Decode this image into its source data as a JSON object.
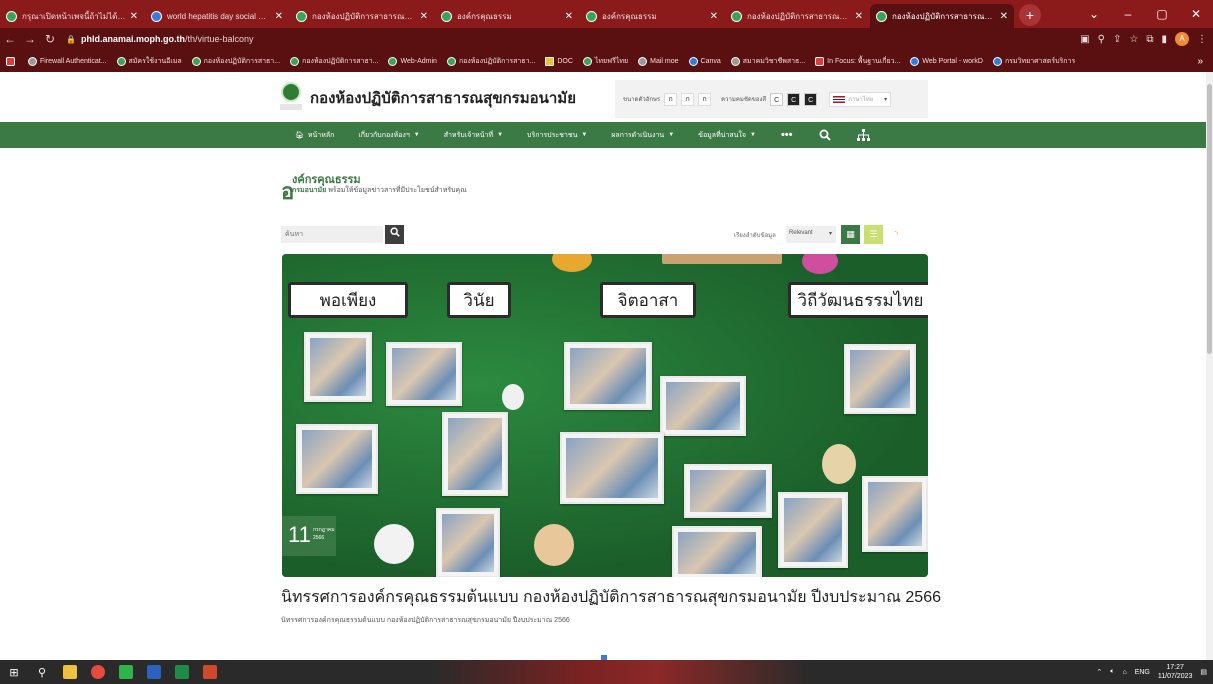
{
  "browser": {
    "tabs": [
      {
        "title": "กรุณาเปิดหน้าเพจนี้ถ้าไม่ได้รับ",
        "active": false
      },
      {
        "title": "world hepatitis day social med",
        "active": false
      },
      {
        "title": "กองห้องปฏิบัติการสาธารณสุขกรม",
        "active": false
      },
      {
        "title": "องค์กรคุณธรรม",
        "active": false
      },
      {
        "title": "องค์กรคุณธรรม",
        "active": false
      },
      {
        "title": "กองห้องปฏิบัติการสาธารณสุขกรม",
        "active": false
      },
      {
        "title": "กองห้องปฏิบัติการสาธารณสุขกรม",
        "active": true
      }
    ],
    "new_tab": "+",
    "window_controls": {
      "minimize": "–",
      "maximize": "▢",
      "close": "✕"
    },
    "url_domain": "phld.anamai.moph.go.th",
    "url_path": "/th/virtue-balcony",
    "bookmarks": [
      {
        "label": "Firewall Authenticat...",
        "icon": "grey"
      },
      {
        "label": "สมัครใช้งานอีเมล",
        "icon": "green"
      },
      {
        "label": "กองห้องปฏิบัติการสาธา...",
        "icon": "green"
      },
      {
        "label": "กองห้องปฏิบัติการสาธา...",
        "icon": "green"
      },
      {
        "label": "Web-Admin",
        "icon": "green"
      },
      {
        "label": "กองห้องปฏิบัติการสาธา...",
        "icon": "green"
      },
      {
        "label": "DOC",
        "icon": "yellow"
      },
      {
        "label": "ไทยฟรีไทย",
        "icon": "green"
      },
      {
        "label": "Mail moe",
        "icon": "grey"
      },
      {
        "label": "Canva",
        "icon": "blue"
      },
      {
        "label": "สมาคมวิชาชีพสาธ...",
        "icon": "grey"
      },
      {
        "label": "In Focus: พื้นฐานเกี่ยว...",
        "icon": "red"
      },
      {
        "label": "Web Portal - workD",
        "icon": "blue"
      },
      {
        "label": "กรมวิทยาศาสตร์บริการ",
        "icon": "blue"
      }
    ],
    "bookmarks_more": "»"
  },
  "site": {
    "title": "กองห้องปฏิบัติการสาธารณสุขกรมอนามัย",
    "font_size_label": "ขนาดตัวอักษร",
    "font_sizes": [
      "ก",
      "ก",
      "ก"
    ],
    "contrast_label": "ความคมชัดของสี",
    "contrast_options": [
      "C",
      "C",
      "C"
    ],
    "language": "ภาษาไทย"
  },
  "nav": [
    {
      "label": "หน้าหลัก",
      "icon": "home",
      "dropdown": false
    },
    {
      "label": "เกี่ยวกับกองห้องฯ",
      "dropdown": true
    },
    {
      "label": "สำหรับเจ้าหน้าที่",
      "dropdown": true
    },
    {
      "label": "บริการประชาชน",
      "dropdown": true
    },
    {
      "label": "ผลการดำเนินงาน",
      "dropdown": true
    },
    {
      "label": "ข้อมูลที่น่าสนใจ",
      "dropdown": true
    }
  ],
  "nav_icons": {
    "more": "•••",
    "search": "search",
    "sitemap": "sitemap"
  },
  "section": {
    "heading_initial": "อ",
    "heading": "งค์กรคุณธรรม",
    "sub_bold": "กรมอนามัย",
    "sub_rest": " พร้อมให้ข้อมูลข่าวสารที่มีประโยชน์สำหรับคุณ"
  },
  "toolbar": {
    "search_placeholder": "ค้นหา",
    "sort_label": "เรียงลำดับข้อมูล",
    "sort_value": "Relevant"
  },
  "hero": {
    "signs": [
      "พอเพียง",
      "วินัย",
      "จิตอาสา",
      "วิถีวัฒนธรรมไทย"
    ],
    "date_day": "11",
    "date_month": "กรกฎาคม",
    "date_year": "2566"
  },
  "post": {
    "title": "นิทรรศการองค์กรคุณธรรมต้นแบบ กองห้องปฏิบัติการสาธารณสุขกรมอนามัย ปีงบประมาณ 2566",
    "excerpt": "นิทรรศการองค์กรคุณธรรมต้นแบบ กองห้องปฏิบัติการสาธารณสุขกรมอนามัย ปีงบประมาณ 2566"
  },
  "taskbar": {
    "lang": "ENG",
    "time": "17:27",
    "date": "11/07/2023"
  }
}
